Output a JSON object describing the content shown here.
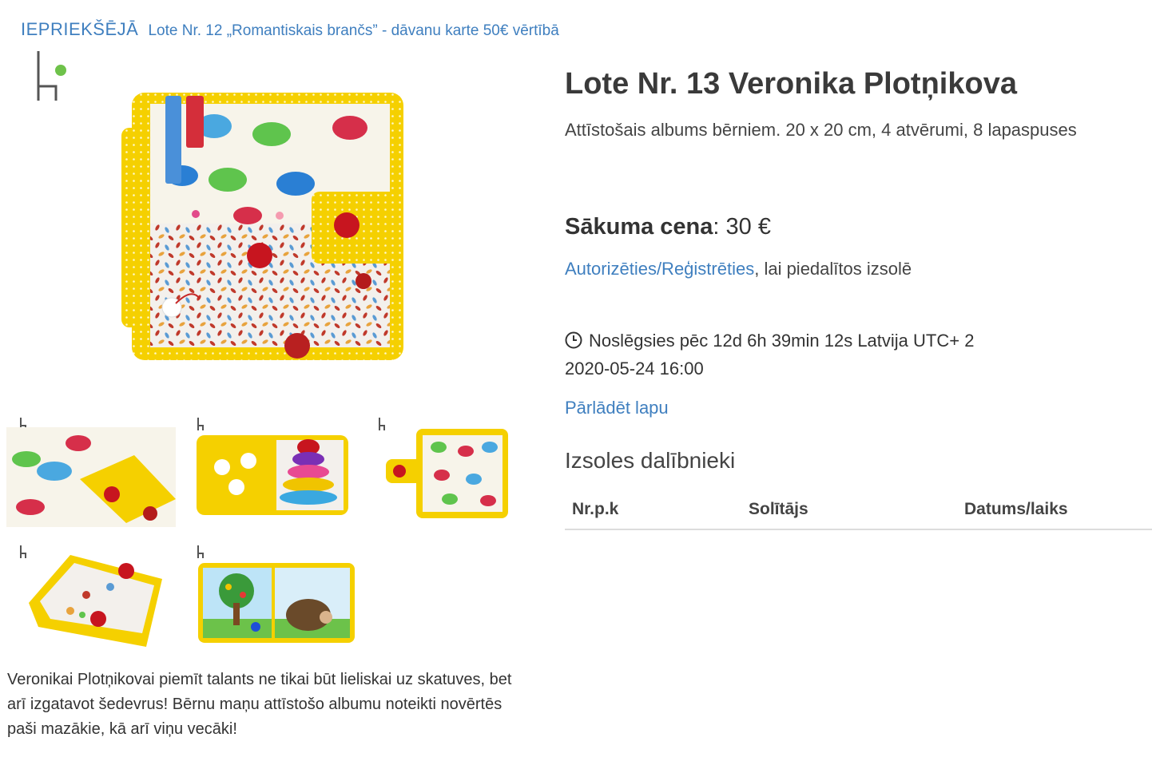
{
  "nav": {
    "prev_keyword": "IEPRIEKŠĒJĀ",
    "prev_title": "Lote Nr. 12 „Romantiskais brančs” - dāvanu karte 50€ vērtībā"
  },
  "lot": {
    "title": "Lote Nr. 13 Veronika Plotņikova",
    "subtitle": "Attīstošais albums bērniem. 20 x 20 cm, 4 atvērumi, 8 lapaspuses",
    "price_label": "Sākuma cena",
    "price_value": "30 €",
    "auth_link": "Autorizēties/Reģistrēties",
    "auth_suffix": ", lai piedalītos izsolē",
    "countdown": "Noslēgsies pēc 12d 6h 39min 12s Latvija UTC+ 2",
    "end_datetime": "2020-05-24 16:00",
    "reload_label": "Pārlādēt lapu"
  },
  "bidders": {
    "title": "Izsoles dalībnieki",
    "columns": [
      "Nr.p.k",
      "Solītājs",
      "Datums/laiks"
    ]
  },
  "description": "Veronikai Plotņikovai piemīt talants ne tikai būt lieliskai  uz skatuves, bet arī izgatavot šedevrus! Bērnu maņu attīstošo albumu noteikti novērtēs paši mazākie, kā arī viņu vecāki!",
  "colors": {
    "link": "#3f7fbf",
    "felt_yellow": "#f5d000",
    "logo_green": "#6ec24a"
  },
  "icons": {
    "clock": "clock-icon",
    "logo": "brand-logo-icon"
  }
}
